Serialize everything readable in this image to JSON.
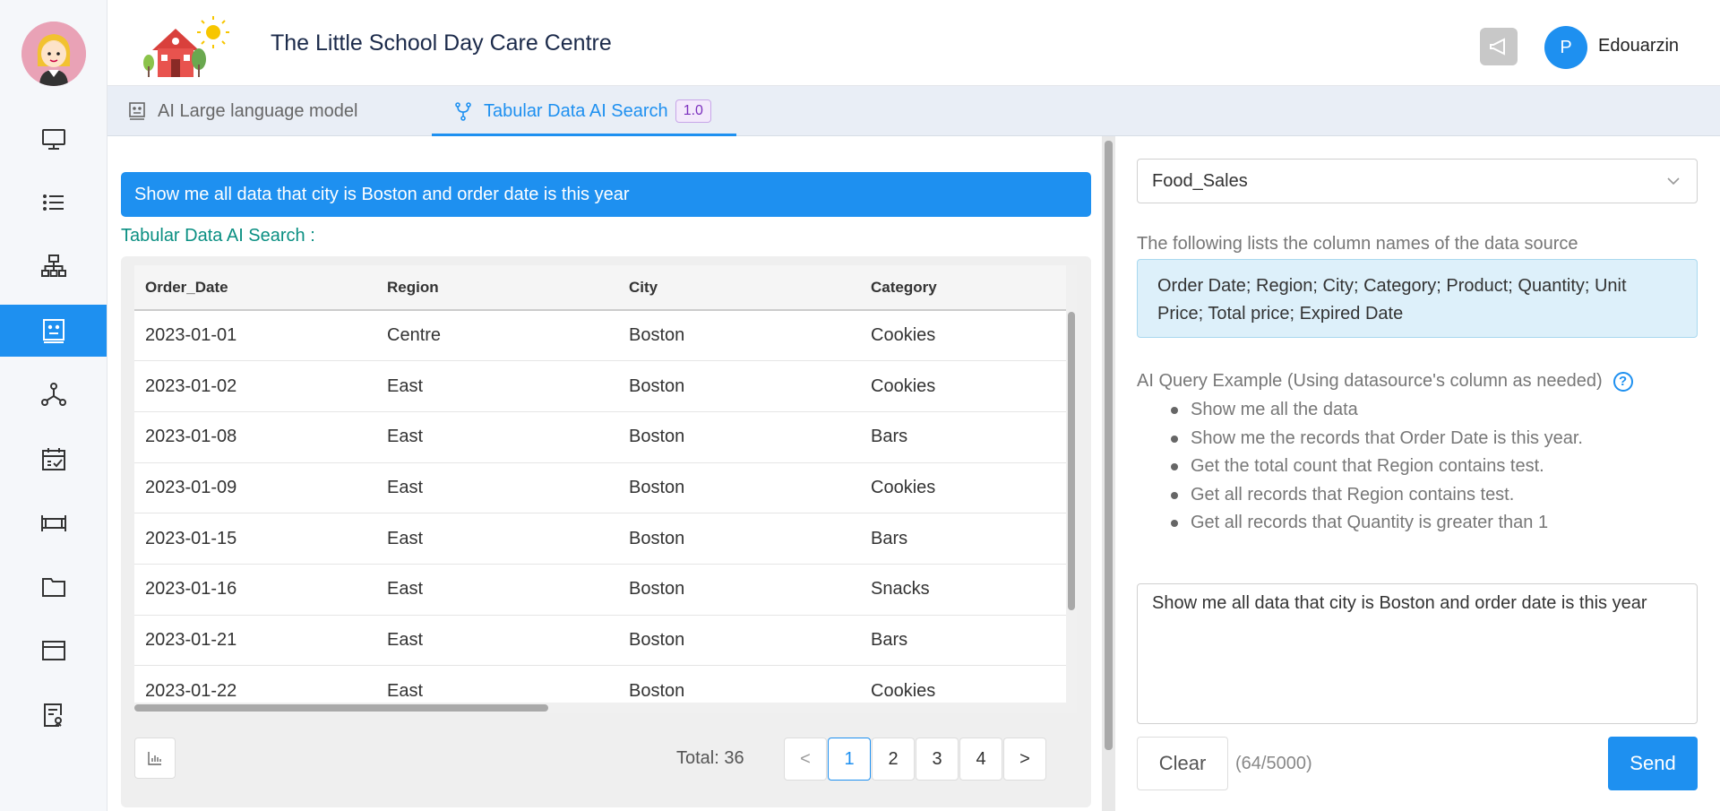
{
  "header": {
    "title": "The Little School Day Care Centre",
    "user_initial": "P",
    "username": "Edouarzin"
  },
  "sidebar": {
    "items": [
      {
        "icon": "monitor-icon"
      },
      {
        "icon": "list-icon"
      },
      {
        "icon": "org-chart-icon"
      },
      {
        "icon": "robot-face-icon",
        "active": true
      },
      {
        "icon": "network-icon"
      },
      {
        "icon": "calendar-check-icon"
      },
      {
        "icon": "bed-icon"
      },
      {
        "icon": "folder-icon"
      },
      {
        "icon": "card-icon"
      },
      {
        "icon": "report-icon"
      }
    ]
  },
  "tabs": [
    {
      "label": "AI Large language model",
      "icon": "robot-face-icon"
    },
    {
      "label": "Tabular Data AI Search",
      "icon": "branch-icon",
      "badge": "1.0",
      "active": true
    }
  ],
  "conversation": {
    "query": "Show me all data that city is Boston and order date is this year",
    "result_label": "Tabular Data AI Search :"
  },
  "table": {
    "columns": [
      "Order_Date",
      "Region",
      "City",
      "Category"
    ],
    "rows": [
      [
        "2023-01-01",
        "Centre",
        "Boston",
        "Cookies"
      ],
      [
        "2023-01-02",
        "East",
        "Boston",
        "Cookies"
      ],
      [
        "2023-01-08",
        "East",
        "Boston",
        "Bars"
      ],
      [
        "2023-01-09",
        "East",
        "Boston",
        "Cookies"
      ],
      [
        "2023-01-15",
        "East",
        "Boston",
        "Bars"
      ],
      [
        "2023-01-16",
        "East",
        "Boston",
        "Snacks"
      ],
      [
        "2023-01-21",
        "East",
        "Boston",
        "Bars"
      ],
      [
        "2023-01-22",
        "East",
        "Boston",
        "Cookies"
      ]
    ]
  },
  "pagination": {
    "total_text": "Total: 36",
    "prev": "<",
    "next": ">",
    "pages": [
      "1",
      "2",
      "3",
      "4"
    ],
    "current": "1"
  },
  "right": {
    "datasource": "Food_Sales",
    "cols_label": "The following lists the column names of the data source",
    "cols_text": "Order Date; Region; City; Category; Product; Quantity; Unit Price; Total price; Expired Date",
    "example_label": "AI Query Example (Using datasource's column as needed)",
    "help": "?",
    "examples": [
      "Show me all the data",
      "Show me the records that Order Date is this year.",
      "Get the total count that Region contains test.",
      "Get all records that Region contains test.",
      "Get all records that Quantity is greater than 1"
    ],
    "input_value": "Show me all data that city is Boston and order date is this year",
    "clear_label": "Clear",
    "counter": "(64/5000)",
    "send_label": "Send"
  },
  "colors": {
    "accent": "#1e90f0",
    "result_label": "#0a8f82",
    "badge": "#7b2fbe"
  }
}
